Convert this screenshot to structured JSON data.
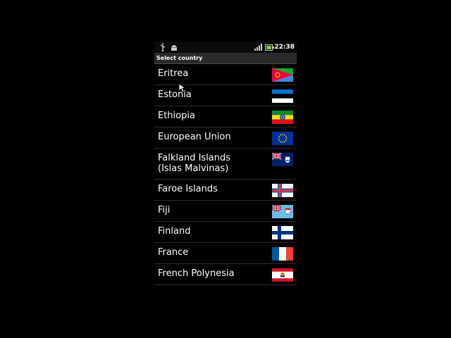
{
  "status_bar": {
    "time": "22:38",
    "icons": [
      "usb-icon",
      "android-debug-icon",
      "signal-icon",
      "battery-icon"
    ]
  },
  "title": "Select country",
  "countries": [
    {
      "name": "Eritrea",
      "flag": "eritrea-flag"
    },
    {
      "name": "Estonia",
      "flag": "estonia-flag"
    },
    {
      "name": "Ethiopia",
      "flag": "ethiopia-flag"
    },
    {
      "name": "European Union",
      "flag": "european-union-flag"
    },
    {
      "name": "Falkland Islands (Islas Malvinas)",
      "flag": "falkland-islands-flag"
    },
    {
      "name": "Faroe Islands",
      "flag": "faroe-islands-flag"
    },
    {
      "name": "Fiji",
      "flag": "fiji-flag"
    },
    {
      "name": "Finland",
      "flag": "finland-flag"
    },
    {
      "name": "France",
      "flag": "france-flag"
    },
    {
      "name": "French Polynesia",
      "flag": "french-polynesia-flag"
    }
  ]
}
